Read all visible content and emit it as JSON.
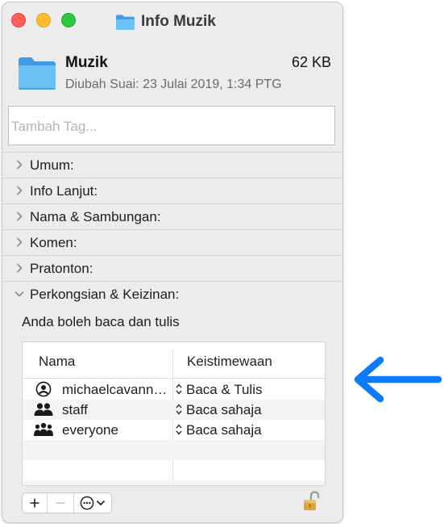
{
  "window": {
    "title": "Info Muzik",
    "folder_icon": "folder-icon"
  },
  "header": {
    "name": "Muzik",
    "size": "62 KB",
    "modified": "Diubah Suai: 23 Julai 2019, 1:34 PTG"
  },
  "tags": {
    "placeholder": "Tambah Tag..."
  },
  "sections": [
    {
      "label": "Umum:",
      "expanded": false
    },
    {
      "label": "Info Lanjut:",
      "expanded": false
    },
    {
      "label": "Nama & Sambungan:",
      "expanded": false
    },
    {
      "label": "Komen:",
      "expanded": false
    },
    {
      "label": "Pratonton:",
      "expanded": false
    },
    {
      "label": "Perkongsian & Keizinan:",
      "expanded": true
    }
  ],
  "permissions": {
    "note": "Anda boleh baca dan tulis",
    "columns": [
      "Nama",
      "Keistimewaan"
    ],
    "rows": [
      {
        "name": "michaelcavann…",
        "privilege": "Baca & Tulis",
        "icon": "user-icon"
      },
      {
        "name": "staff",
        "privilege": "Baca sahaja",
        "icon": "group-icon"
      },
      {
        "name": "everyone",
        "privilege": "Baca sahaja",
        "icon": "everyone-icon"
      }
    ]
  },
  "toolbar": {
    "add": "+",
    "remove": "−"
  },
  "colors": {
    "accent": "#0a7aff",
    "folder": "#5ab4f0",
    "lock": "#e3a33a"
  }
}
